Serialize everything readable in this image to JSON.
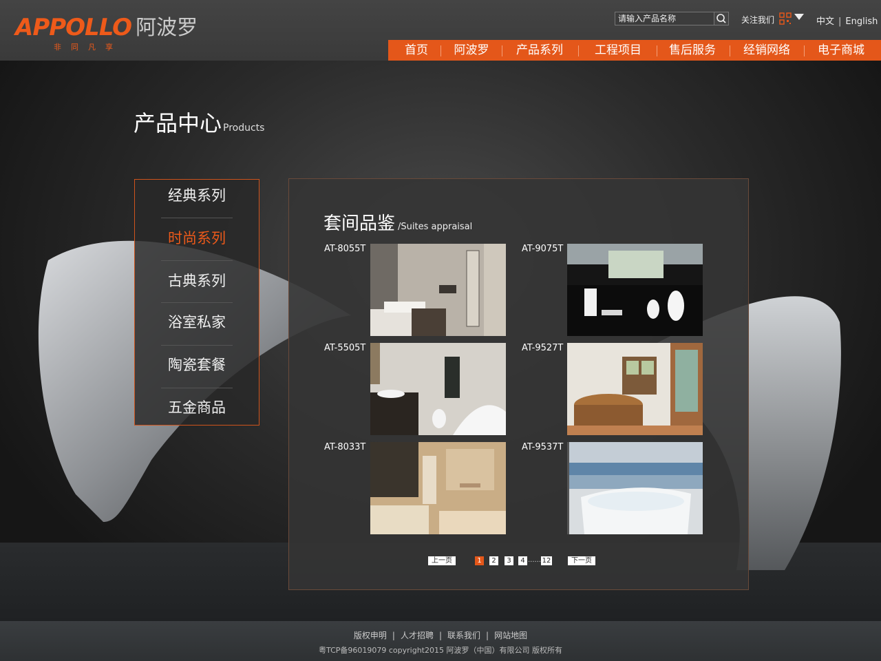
{
  "brand": {
    "name_en": "APPOLLO",
    "name_cn": "阿波罗",
    "slogan": "非同凡享",
    "accent_color": "#e4571a"
  },
  "header": {
    "search_placeholder": "请输入产品名称",
    "follow_label": "关注我们",
    "lang_cn": "中文",
    "lang_sep": "|",
    "lang_en": "English"
  },
  "nav": {
    "items": [
      "首页",
      "阿波罗",
      "产品系列",
      "工程项目",
      "售后服务",
      "经销网络",
      "电子商城"
    ]
  },
  "page": {
    "title_cn": "产品中心",
    "title_en": "Products"
  },
  "sidebar": {
    "items": [
      {
        "label": "经典系列",
        "active": false
      },
      {
        "label": "时尚系列",
        "active": true
      },
      {
        "label": "古典系列",
        "active": false
      },
      {
        "label": "浴室私家",
        "active": false
      },
      {
        "label": "陶瓷套餐",
        "active": false
      },
      {
        "label": "五金商品",
        "active": false
      }
    ]
  },
  "content": {
    "title_cn": "套间品鉴",
    "title_en": "/Suites appraisal",
    "products": [
      {
        "code": "AT-8055T"
      },
      {
        "code": "AT-9075T"
      },
      {
        "code": "AT-5505T"
      },
      {
        "code": "AT-9527T"
      },
      {
        "code": "AT-8033T"
      },
      {
        "code": "AT-9537T"
      }
    ]
  },
  "pager": {
    "prev": "上一页",
    "next": "下一页",
    "pages": [
      "1",
      "2",
      "3",
      "4"
    ],
    "current": "1",
    "ellipsis": "......",
    "last": "12"
  },
  "footer": {
    "links": [
      "版权申明",
      "人才招聘",
      "联系我们",
      "网站地图"
    ],
    "link_sep": "|",
    "copyright": "粤TCP备96019079  copyright2015  阿波罗（中国）有限公司 版权所有"
  }
}
